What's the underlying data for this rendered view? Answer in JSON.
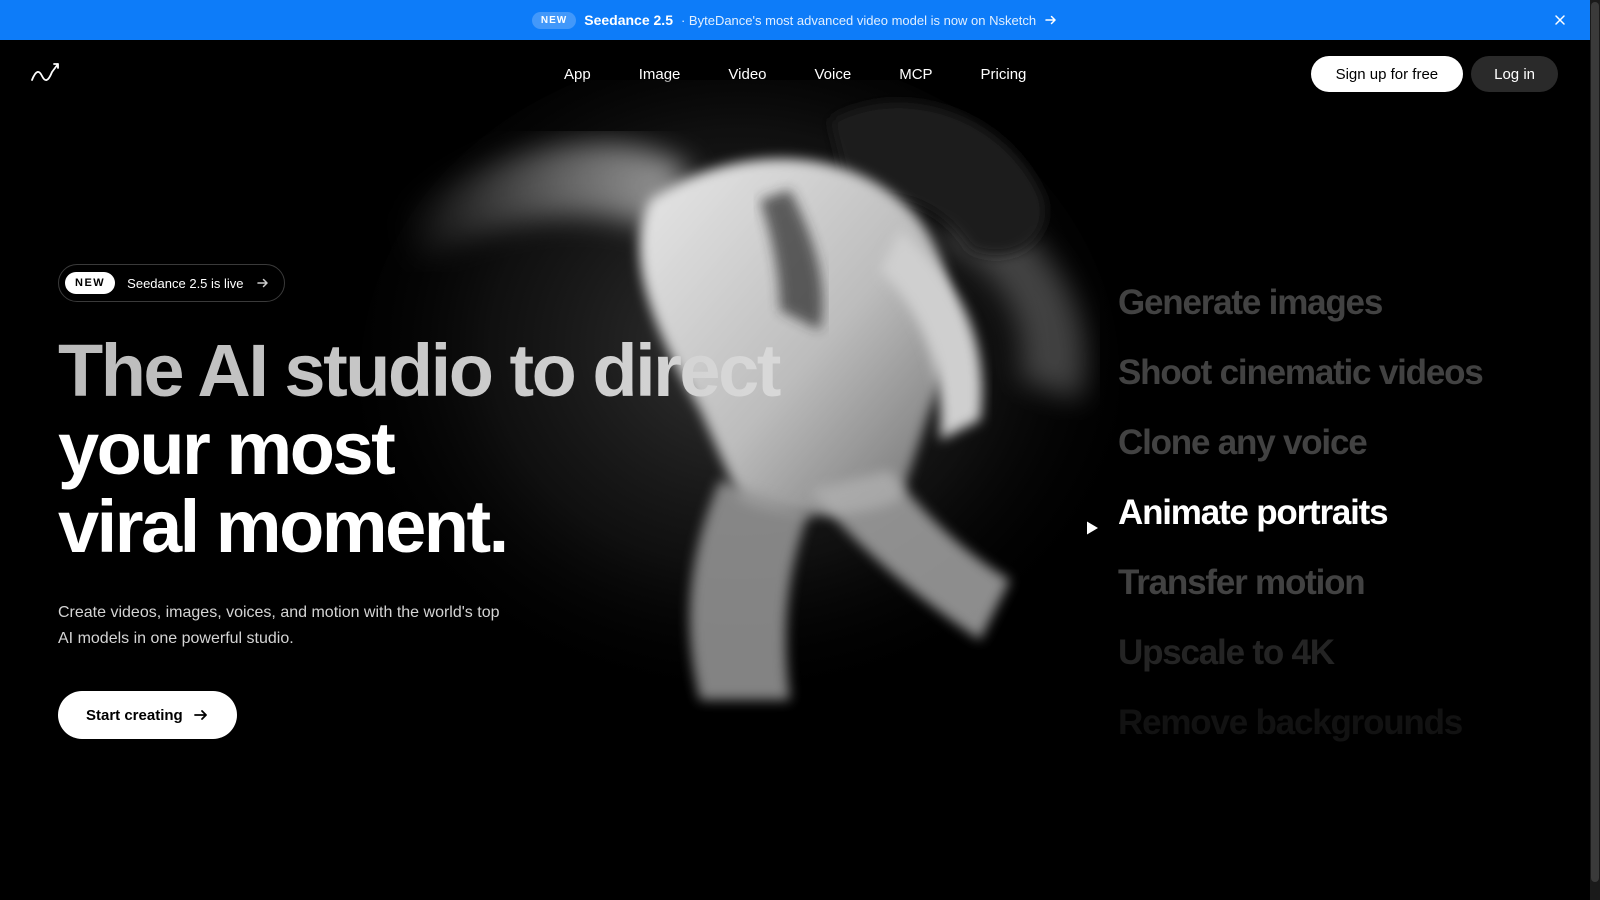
{
  "announcement": {
    "badge": "NEW",
    "product": "Seedance 2.5",
    "message": "· ByteDance's most advanced video model is now on Nsketch",
    "arrow_icon": "arrow-right-icon",
    "close_icon": "close-icon",
    "background": "#0d7cf9"
  },
  "header": {
    "logo_icon": "nsketch-logo-icon",
    "nav": [
      "App",
      "Image",
      "Video",
      "Voice",
      "MCP",
      "Pricing"
    ],
    "signup_label": "Sign up for free",
    "login_label": "Log in"
  },
  "hero": {
    "badge": {
      "pill": "NEW",
      "text": "Seedance 2.5 is live"
    },
    "headline": {
      "line1": "The AI studio to direct",
      "line2": "your most",
      "line3": "viral moment."
    },
    "subtitle_line1": "Create videos, images, voices, and motion with the world's top",
    "subtitle_line2": "AI models in one powerful studio.",
    "cta_label": "Start creating"
  },
  "features": {
    "active_index": 3,
    "items": [
      "Generate images",
      "Shoot cinematic videos",
      "Clone any voice",
      "Animate portraits",
      "Transfer motion",
      "Upscale to 4K",
      "Remove backgrounds"
    ]
  }
}
